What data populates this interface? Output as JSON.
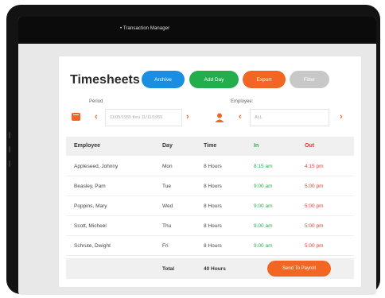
{
  "window": {
    "title": "• Transaction Manager"
  },
  "page": {
    "title": "Timesheets"
  },
  "toolbar": {
    "archive_label": "Archive",
    "add_day_label": "Add Day",
    "export_label": "Export",
    "filter_label": "Filter"
  },
  "filters": {
    "period_label": "Period",
    "period_value": "11/05/1955 thru 11/11/1955",
    "employee_label": "Employee:",
    "employee_value": "ALL"
  },
  "table": {
    "headers": {
      "employee": "Employee",
      "day": "Day",
      "time": "Time",
      "in": "In",
      "out": "Out"
    },
    "rows": [
      {
        "employee": "Appleseed, Johnny",
        "day": "Mon",
        "time": "8 Hours",
        "in": "8:15 am",
        "out": "4:15 pm"
      },
      {
        "employee": "Beasley, Pam",
        "day": "Tue",
        "time": "8 Hours",
        "in": "9:00 am",
        "out": "5:00 pm"
      },
      {
        "employee": "Poppins, Mary",
        "day": "Wed",
        "time": "8 Hours",
        "in": "9:00 am",
        "out": "5:00 pm"
      },
      {
        "employee": "Scott, Micheel",
        "day": "Thu",
        "time": "8 Hours",
        "in": "9:00 am",
        "out": "5:00 pm"
      },
      {
        "employee": "Schrute, Dwight",
        "day": "Fri",
        "time": "8 Hours",
        "in": "9:00 am",
        "out": "5:00 pm"
      }
    ],
    "footer": {
      "total_label": "Total",
      "total_value": "40 Hours",
      "payroll_label": "Send To Payroll"
    }
  },
  "icons": {
    "calendar": "calendar-icon",
    "person": "person-icon",
    "prev": "chevron-left-icon",
    "next": "chevron-right-icon"
  },
  "colors": {
    "primary_blue": "#1a8ee0",
    "green": "#23ae4e",
    "orange": "#f26522",
    "red": "#e83a2e",
    "disabled": "#c8c8c8"
  }
}
